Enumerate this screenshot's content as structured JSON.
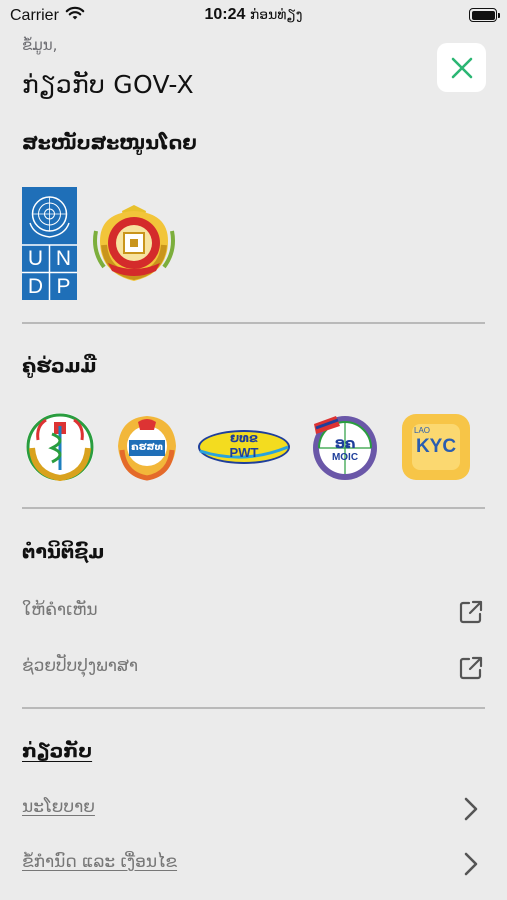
{
  "status": {
    "carrier": "Carrier",
    "time": "10:24",
    "time_suffix": "ກ່ອນທ່ຽງ"
  },
  "header": {
    "breadcrumb": "ຂໍ້ມູນ,",
    "title": "ກ່ຽວກັບ GOV-X",
    "close_icon": "close-icon"
  },
  "sponsors": {
    "title": "ສະໜັບສະໜູນໂດຍ",
    "undp": {
      "row1": [
        "U",
        "N"
      ],
      "row2": [
        "D",
        "P"
      ]
    },
    "logos": [
      "undp-logo",
      "ministry-emblem-logo"
    ]
  },
  "partners": {
    "title": "ຄູ່ຮ່ວມມື",
    "logos": [
      "health-ministry-logo",
      "nast-logo",
      "pwt-logo",
      "moic-logo",
      "laokyc-logo"
    ],
    "pwt_text": {
      "top": "ຍທຂ",
      "bottom": "PWT"
    },
    "moic_text": {
      "top": "ອຄ",
      "bottom": "MOIC"
    },
    "nast_text": "ຄຮສທ",
    "laokyc_text": {
      "top": "LAO",
      "bottom": "KYC"
    }
  },
  "community": {
    "title": "ຕໍານິຕິຊົມ",
    "items": [
      {
        "label": "ໃຫ້ຄໍາເຫັນ",
        "icon": "external-link-icon"
      },
      {
        "label": "ຊ່ວຍປັບປຸງພາສາ",
        "icon": "external-link-icon"
      }
    ]
  },
  "about": {
    "title": "ກ່ຽວກັບ",
    "items": [
      {
        "label": "ນະໂຍບາຍ",
        "icon": "chevron-right-icon"
      },
      {
        "label": "ຂໍ້ກໍານົດ ແລະ ເງື່ອນໄຂ",
        "icon": "chevron-right-icon"
      }
    ]
  },
  "colors": {
    "accent": "#2bb673",
    "background": "#ebebeb",
    "undp_blue": "#1f6fb8"
  }
}
